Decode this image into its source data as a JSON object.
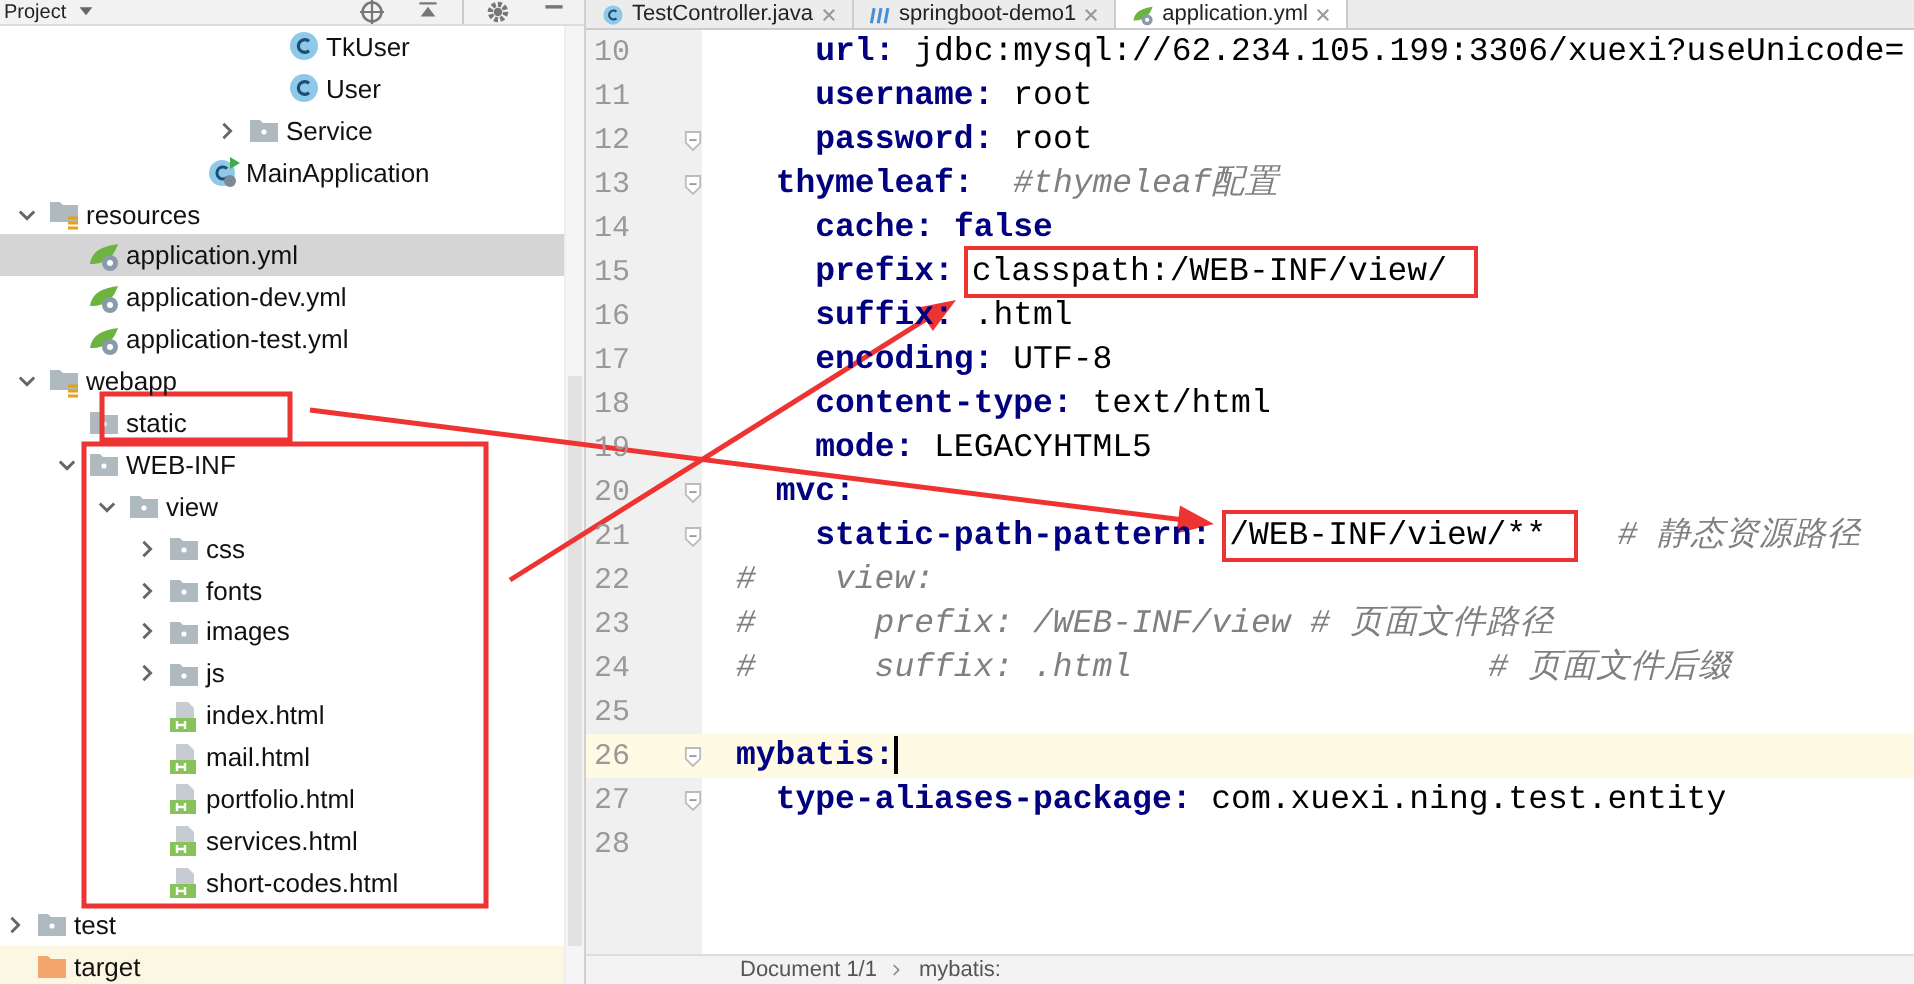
{
  "project_panel": {
    "title": "Project",
    "tree": [
      {
        "children": [
          {
            "children": [
              {
                "children": [
                  {
                    "children": [
                      {
                        "children": [
                          {
                            "children": [
                              {
                                "children": [
                                  {
                                    "label": "TkUser",
                                    "kind": "class",
                                    "selected": false
                                  },
                                  {
                                    "label": "User",
                                    "kind": "class",
                                    "selected": false
                                  }
                                ]
                              },
                              {
                                "label": "Service",
                                "kind": "folder",
                                "expanded": false,
                                "selected": false
                              }
                            ]
                          },
                          {
                            "label": "MainApplication",
                            "kind": "main-class",
                            "selected": false
                          }
                        ]
                      }
                    ]
                  }
                ]
              }
            ]
          },
          {
            "label": "resources",
            "kind": "resource-folder",
            "expanded": true,
            "selected": false,
            "children": [
              {
                "label": "application.yml",
                "kind": "spring-config",
                "selected": true
              },
              {
                "label": "application-dev.yml",
                "kind": "spring-config",
                "selected": false
              },
              {
                "label": "application-test.yml",
                "kind": "spring-config",
                "selected": false
              }
            ]
          },
          {
            "label": "webapp",
            "kind": "resource-folder",
            "expanded": true,
            "selected": false,
            "children": [
              {
                "label": "static",
                "kind": "folder",
                "selected": false
              },
              {
                "label": "WEB-INF",
                "kind": "folder",
                "expanded": true,
                "selected": false,
                "children": [
                  {
                    "label": "view",
                    "kind": "folder",
                    "expanded": true,
                    "selected": false,
                    "children": [
                      {
                        "label": "css",
                        "kind": "folder",
                        "expanded": false,
                        "selected": false
                      },
                      {
                        "label": "fonts",
                        "kind": "folder",
                        "expanded": false,
                        "selected": false
                      },
                      {
                        "label": "images",
                        "kind": "folder",
                        "expanded": false,
                        "selected": false
                      },
                      {
                        "label": "js",
                        "kind": "folder",
                        "expanded": false,
                        "selected": false
                      },
                      {
                        "label": "index.html",
                        "kind": "html-file",
                        "selected": false
                      },
                      {
                        "label": "mail.html",
                        "kind": "html-file",
                        "selected": false
                      },
                      {
                        "label": "portfolio.html",
                        "kind": "html-file",
                        "selected": false
                      },
                      {
                        "label": "services.html",
                        "kind": "html-file",
                        "selected": false
                      },
                      {
                        "label": "short-codes.html",
                        "kind": "html-file",
                        "selected": false
                      }
                    ]
                  }
                ]
              }
            ]
          }
        ]
      },
      {
        "label": "test",
        "kind": "folder",
        "expanded": false,
        "selected": false
      },
      {
        "label": "target",
        "kind": "excluded-folder",
        "selected": false
      }
    ]
  },
  "editor": {
    "tabs": [
      {
        "label": "TestController.java",
        "kind": "class",
        "selected": false
      },
      {
        "label": "springboot-demo1",
        "kind": "module",
        "selected": false
      },
      {
        "label": "application.yml",
        "kind": "spring-config",
        "selected": true
      }
    ],
    "lines": [
      {
        "number": "10",
        "current": false,
        "fold_marker": false,
        "tokens": [
          {
            "kind": "key",
            "text": "    url:"
          },
          {
            "kind": "value",
            "text": " jdbc:mysql://62.234.105.199:3306/xuexi?useUnicode="
          }
        ]
      },
      {
        "number": "11",
        "current": false,
        "fold_marker": false,
        "tokens": [
          {
            "kind": "key",
            "text": "    username:"
          },
          {
            "kind": "value",
            "text": " root"
          }
        ]
      },
      {
        "number": "12",
        "current": false,
        "fold_marker": true,
        "tokens": [
          {
            "kind": "key",
            "text": "    password:"
          },
          {
            "kind": "value",
            "text": " root"
          }
        ]
      },
      {
        "number": "13",
        "current": false,
        "fold_marker": true,
        "tokens": [
          {
            "kind": "key",
            "text": "  thymeleaf:"
          },
          {
            "kind": "comment",
            "text": "  #thymeleaf配置"
          }
        ]
      },
      {
        "number": "14",
        "current": false,
        "fold_marker": false,
        "tokens": [
          {
            "kind": "key",
            "text": "    cache:"
          },
          {
            "kind": "keyword",
            "text": " false"
          }
        ]
      },
      {
        "number": "15",
        "current": false,
        "fold_marker": false,
        "tokens": [
          {
            "kind": "key",
            "text": "    prefix:"
          },
          {
            "kind": "value",
            "text": " classpath:/WEB-INF/view/",
            "highlighted": true
          }
        ]
      },
      {
        "number": "16",
        "current": false,
        "fold_marker": false,
        "tokens": [
          {
            "kind": "key",
            "text": "    suffix:"
          },
          {
            "kind": "value",
            "text": " .html"
          }
        ]
      },
      {
        "number": "17",
        "current": false,
        "fold_marker": false,
        "tokens": [
          {
            "kind": "key",
            "text": "    encoding:"
          },
          {
            "kind": "value",
            "text": " UTF-8"
          }
        ]
      },
      {
        "number": "18",
        "current": false,
        "fold_marker": false,
        "tokens": [
          {
            "kind": "key",
            "text": "    content-type:"
          },
          {
            "kind": "value",
            "text": " text/html"
          }
        ]
      },
      {
        "number": "19",
        "current": false,
        "fold_marker": false,
        "tokens": [
          {
            "kind": "key",
            "text": "    mode:"
          },
          {
            "kind": "value",
            "text": " LEGACYHTML5"
          }
        ]
      },
      {
        "number": "20",
        "current": false,
        "fold_marker": true,
        "tokens": [
          {
            "kind": "key",
            "text": "  mvc:"
          }
        ]
      },
      {
        "number": "21",
        "current": false,
        "fold_marker": true,
        "tokens": [
          {
            "kind": "key",
            "text": "    static-path-pattern:"
          },
          {
            "kind": "value",
            "text": " /WEB-INF/view/**",
            "highlighted": true
          },
          {
            "kind": "comment",
            "text": "  # 静态资源路径"
          }
        ]
      },
      {
        "number": "22",
        "current": false,
        "fold_marker": false,
        "tokens": [
          {
            "kind": "comment",
            "text": "#    view:"
          }
        ]
      },
      {
        "number": "23",
        "current": false,
        "fold_marker": false,
        "tokens": [
          {
            "kind": "comment",
            "text": "#      prefix: /WEB-INF/view # 页面文件路径"
          }
        ]
      },
      {
        "number": "24",
        "current": false,
        "fold_marker": false,
        "tokens": [
          {
            "kind": "comment",
            "text": "#      suffix: .html                  # 页面文件后缀"
          }
        ]
      },
      {
        "number": "25",
        "current": false,
        "fold_marker": false
      },
      {
        "number": "26",
        "current": true,
        "fold_marker": true,
        "tokens": [
          {
            "kind": "key",
            "text": "mybatis:"
          }
        ]
      },
      {
        "number": "27",
        "current": false,
        "fold_marker": true,
        "tokens": [
          {
            "kind": "key",
            "text": "  type-aliases-package:"
          },
          {
            "kind": "value",
            "text": " com.xuexi.ning.test.entity"
          }
        ]
      },
      {
        "number": "28",
        "current": false,
        "fold_marker": false
      }
    ],
    "breadcrumb": [
      "Document 1/1",
      "mybatis:"
    ]
  }
}
